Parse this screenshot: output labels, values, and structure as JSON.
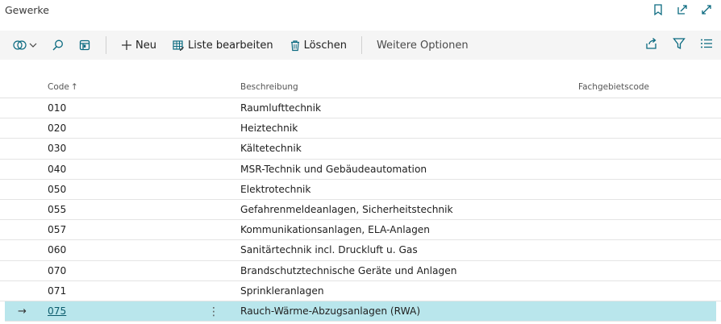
{
  "window": {
    "title": "Gewerke"
  },
  "toolbar": {
    "new_label": "Neu",
    "edit_list_label": "Liste bearbeiten",
    "delete_label": "Löschen",
    "more_options_label": "Weitere Optionen"
  },
  "table": {
    "headers": {
      "code": "Code",
      "sort_indicator": "↑",
      "description": "Beschreibung",
      "domain_code": "Fachgebietscode"
    },
    "rows": [
      {
        "code": "010",
        "description": "Raumlufttechnik",
        "domain_code": ""
      },
      {
        "code": "020",
        "description": "Heiztechnik",
        "domain_code": ""
      },
      {
        "code": "030",
        "description": "Kältetechnik",
        "domain_code": ""
      },
      {
        "code": "040",
        "description": "MSR-Technik und Gebäudeautomation",
        "domain_code": ""
      },
      {
        "code": "050",
        "description": "Elektrotechnik",
        "domain_code": ""
      },
      {
        "code": "055",
        "description": "Gefahrenmeldeanlagen, Sicherheitstechnik",
        "domain_code": ""
      },
      {
        "code": "057",
        "description": "Kommunikationsanlagen, ELA-Anlagen",
        "domain_code": ""
      },
      {
        "code": "060",
        "description": "Sanitärtechnik incl. Druckluft u. Gas",
        "domain_code": ""
      },
      {
        "code": "070",
        "description": "Brandschutztechnische Geräte und Anlagen",
        "domain_code": ""
      },
      {
        "code": "071",
        "description": "Sprinkleranlagen",
        "domain_code": ""
      },
      {
        "code": "075",
        "description": "Rauch-Wärme-Abzugsanlagen (RWA)",
        "domain_code": ""
      }
    ],
    "selected_row_marker": "→",
    "row_menu_glyph": "⋮"
  },
  "colors": {
    "toolbar_bg": "#f5f5f5",
    "selected_row_bg": "#b9e6ec",
    "accent": "#0b5b6b"
  }
}
